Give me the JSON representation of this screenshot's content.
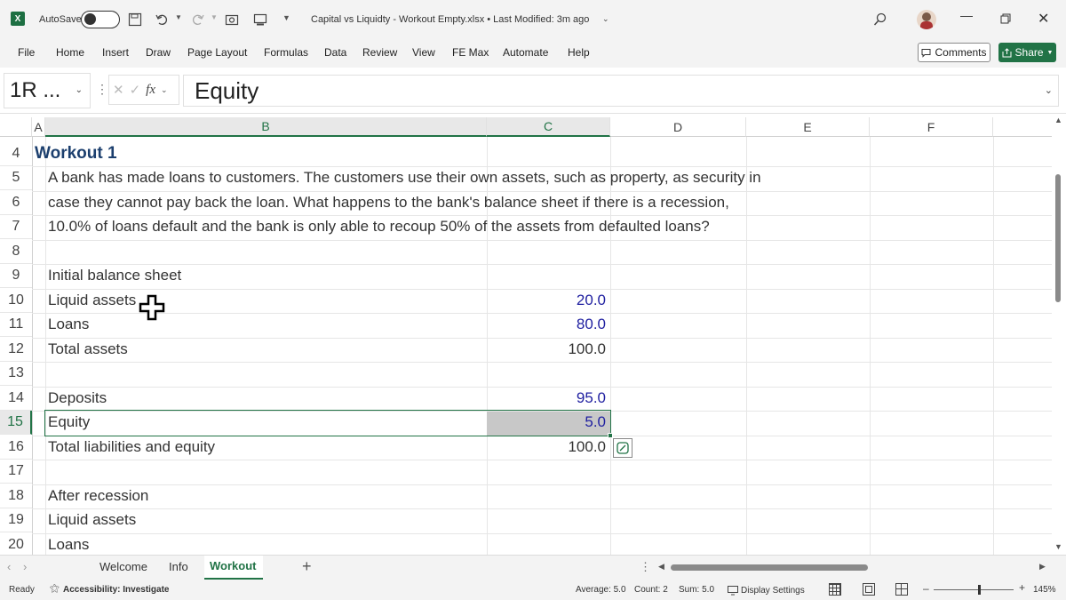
{
  "titlebar": {
    "autosave_label": "AutoSave",
    "file_title": "Capital vs Liquidty - Workout Empty.xlsx • Last Modified: 3m ago"
  },
  "menu": {
    "items": [
      "File",
      "Home",
      "Insert",
      "Draw",
      "Page Layout",
      "Formulas",
      "Data",
      "Review",
      "View",
      "FE Max",
      "Automate",
      "Help"
    ],
    "comments_label": "Comments",
    "share_label": "Share"
  },
  "formula": {
    "name_box": "1R ...",
    "fx_label": "fx",
    "content": "Equity"
  },
  "columns": [
    "A",
    "B",
    "C",
    "D",
    "E",
    "F"
  ],
  "rows": [
    "4",
    "5",
    "6",
    "7",
    "8",
    "9",
    "10",
    "11",
    "12",
    "13",
    "14",
    "15",
    "16",
    "17",
    "18",
    "19",
    "20"
  ],
  "cells": {
    "r4_a": "Workout 1",
    "r5_b": "A bank has made loans to customers. The customers use their own assets, such as property, as security in",
    "r6_b": "case they cannot pay back the loan. What happens to the bank's balance sheet if there is a recession,",
    "r7_b": "10.0% of loans default and the bank is only able to recoup 50% of the assets from defaulted loans?",
    "r9_b": "Initial balance sheet",
    "r10_b": "Liquid assets",
    "r10_c": "20.0",
    "r11_b": "Loans",
    "r11_c": "80.0",
    "r12_b": "Total assets",
    "r12_c": "100.0",
    "r14_b": "Deposits",
    "r14_c": "95.0",
    "r15_b": "Equity",
    "r15_c": "5.0",
    "r16_b": "Total liabilities and equity",
    "r16_c": "100.0",
    "r18_b": "After recession",
    "r19_b": "Liquid assets",
    "r20_b": "Loans"
  },
  "sheets": {
    "tabs": [
      "Welcome",
      "Info",
      "Workout"
    ],
    "active": "Workout",
    "add_label": "+"
  },
  "status": {
    "ready": "Ready",
    "accessibility": "Accessibility: Investigate",
    "average": "Average: 5.0",
    "count": "Count: 2",
    "sum": "Sum: 5.0",
    "display_settings": "Display Settings",
    "zoom": "145%"
  },
  "colors": {
    "accent": "#217346",
    "input_blue": "#1f1fa0",
    "selection_fill": "#c8c8c8"
  }
}
